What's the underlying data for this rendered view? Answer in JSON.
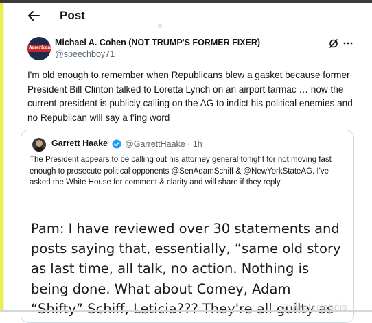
{
  "header": {
    "title": "Post",
    "back_icon": "arrow-left-icon"
  },
  "post": {
    "author": {
      "name": "Michael A. Cohen (NOT TRUMP'S FORMER FIXER)",
      "handle": "@speechboy71",
      "avatar_text": "American"
    },
    "text": "I'm old enough to remember when Republicans blew a gasket because former President Bill Clinton talked to Loretta Lynch on an airport tarmac … now the current president is publicly calling on the AG to indict his political enemies and no Republican will say a f'ing word"
  },
  "quote": {
    "author": {
      "name": "Garrett Haake",
      "handle_time": "@GarrettHaake · 1h"
    },
    "text": "The President appears to be calling out his attorney general tonight for not moving fast enough to prosecute political opponents @SenAdamSchiff & @NewYorkStateAG. I've asked the White House for comment & clarity and will share if they reply.",
    "image_text": "Pam: I have reviewed over 30 statements and posts saying that, essentially, “same old story as last time, all talk, no action. Nothing is being done. What about Comey, Adam “Shifty” Schiff, Leticia??? They're all guilty as"
  },
  "watermark": "ShÄrplerlebnis",
  "colors": {
    "text": "#0f1419",
    "secondary": "#536471",
    "verified": "#1d9bf0",
    "border": "#cfd9de",
    "accent_bar": "#e9f04a"
  }
}
